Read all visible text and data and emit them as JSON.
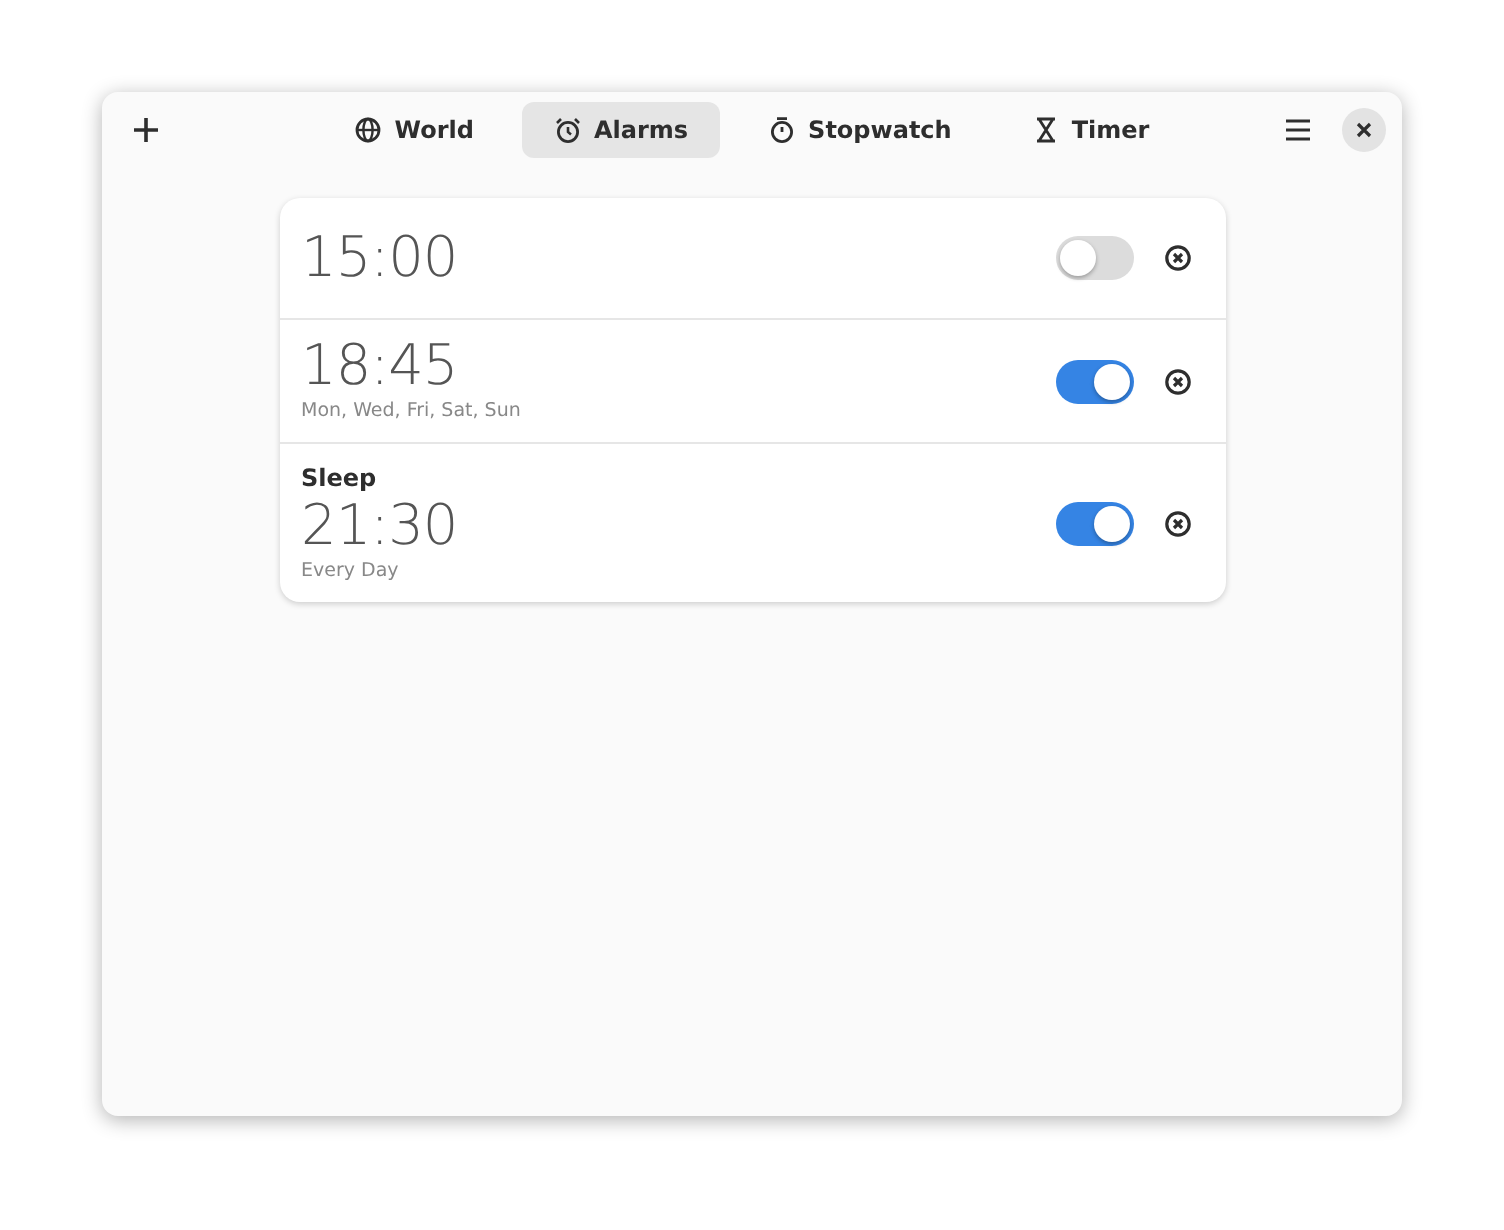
{
  "tabs": [
    {
      "label": "World",
      "selected": false
    },
    {
      "label": "Alarms",
      "selected": true
    },
    {
      "label": "Stopwatch",
      "selected": false
    },
    {
      "label": "Timer",
      "selected": false
    }
  ],
  "alarms": [
    {
      "time": "15:00",
      "on": false
    },
    {
      "time": "18:45",
      "repeat": "Mon, Wed, Fri, Sat, Sun",
      "on": true
    },
    {
      "name": "Sleep",
      "time": "21:30",
      "repeat": "Every Day",
      "on": true
    }
  ]
}
